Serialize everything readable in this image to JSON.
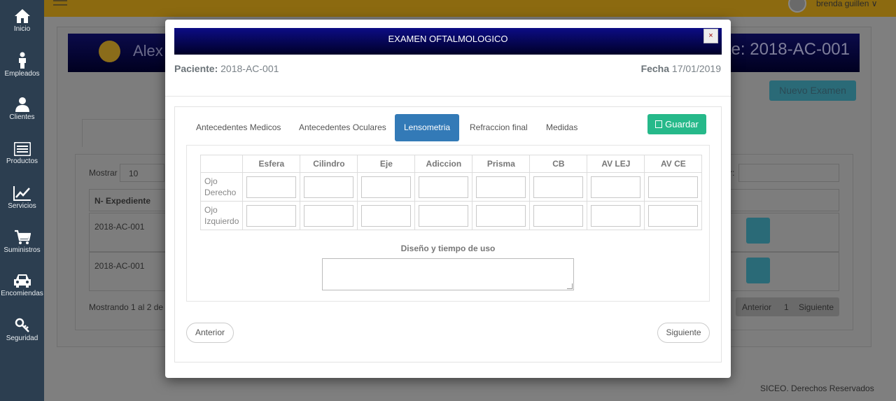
{
  "sidebar": {
    "items": [
      {
        "label": "Inicio",
        "icon": "home-icon"
      },
      {
        "label": "Empleados",
        "icon": "person-icon"
      },
      {
        "label": "Clientes",
        "icon": "user-icon"
      },
      {
        "label": "Productos",
        "icon": "list-icon"
      },
      {
        "label": "Servicios",
        "icon": "chart-line-icon"
      },
      {
        "label": "Suministros",
        "icon": "cart-icon"
      },
      {
        "label": "Encomiendas",
        "icon": "car-icon"
      },
      {
        "label": "Seguridad",
        "icon": "key-icon"
      }
    ]
  },
  "topbar": {
    "user_name": "brenda guillen ∨"
  },
  "background": {
    "banner_name": "Alex",
    "banner_right": "nte: 2018-AC-001",
    "nuevo_examen": "Nuevo Examen",
    "mostrar_label": "Mostrar",
    "mostrar_value": "10",
    "search_label": "r:",
    "col_header": "N- Expediente",
    "rows": [
      "2018-AC-001",
      "2018-AC-001"
    ],
    "mostrando": "Mostrando 1 al 2 de 2",
    "pager": {
      "prev": "Anterior",
      "page": "1",
      "next": "Siguiente"
    },
    "footer": "SICEO. Derechos Reservados"
  },
  "modal": {
    "title": "EXAMEN OFTALMOLOGICO",
    "close": "×",
    "patient_label": "Paciente:",
    "patient_value": "2018-AC-001",
    "fecha_label": "Fecha",
    "fecha_value": "17/01/2019",
    "tabs": [
      {
        "label": "Antecedentes Medicos",
        "active": false
      },
      {
        "label": "Antecedentes Oculares",
        "active": false
      },
      {
        "label": "Lensometria",
        "active": true
      },
      {
        "label": "Refraccion final",
        "active": false
      },
      {
        "label": "Medidas",
        "active": false
      }
    ],
    "save_label": "Guardar",
    "table": {
      "columns": [
        "Esfera",
        "Cilindro",
        "Eje",
        "Adiccion",
        "Prisma",
        "CB",
        "AV LEJ",
        "AV CE"
      ],
      "rows": [
        {
          "label_line1": "Ojo",
          "label_line2": "Derecho"
        },
        {
          "label_line1": "Ojo",
          "label_line2": "Izquierdo"
        }
      ]
    },
    "diseno_label": "Diseño y tiempo de uso",
    "prev_label": "Anterior",
    "next_label": "Siguiente"
  },
  "colors": {
    "sidebar": "#2c3e50",
    "topbar": "#e3a51d",
    "active_tab": "#337ab7",
    "save_button": "#26b98a",
    "title_bar": "#0c0c85"
  }
}
